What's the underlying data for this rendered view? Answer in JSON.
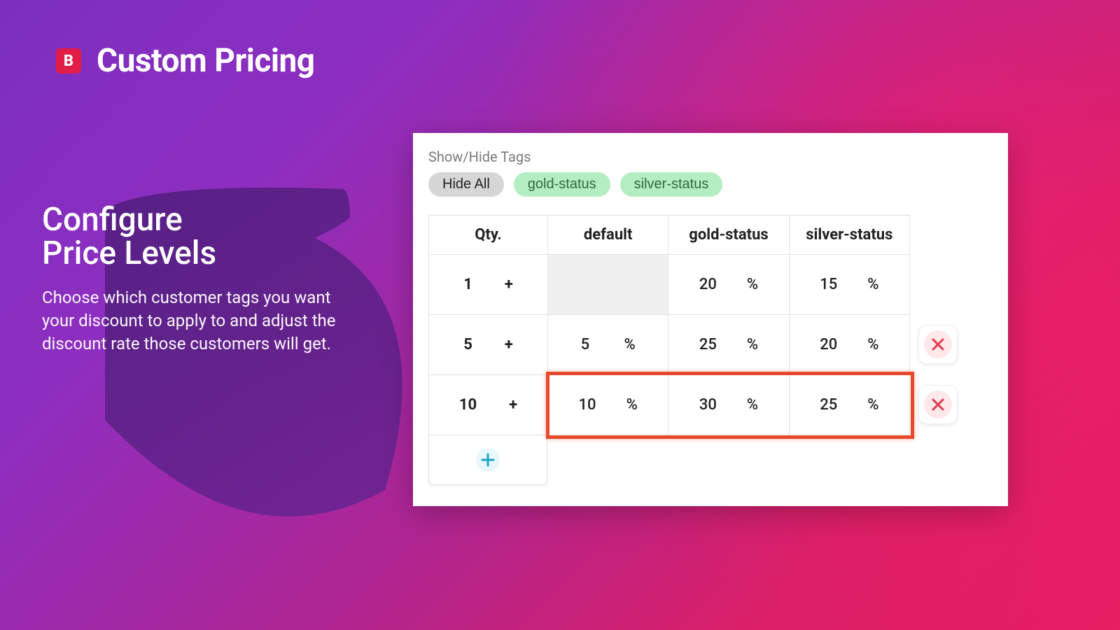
{
  "header": {
    "logo_letter": "B",
    "title": "Custom Pricing"
  },
  "copy": {
    "heading_l1": "Configure",
    "heading_l2": "Price Levels",
    "body": "Choose which customer tags you want your discount to apply to and adjust the discount rate those customers will get."
  },
  "tags": {
    "section_label": "Show/Hide Tags",
    "hide_all": "Hide All",
    "items": [
      "gold-status",
      "silver-status"
    ]
  },
  "table": {
    "columns": {
      "qty": "Qty.",
      "c0": "default",
      "c1": "gold-status",
      "c2": "silver-status"
    },
    "unit": "%",
    "qty_suffix": "+",
    "rows": [
      {
        "qty": "1",
        "default": "",
        "gold": "20",
        "silver": "15",
        "default_disabled": true,
        "deletable": false
      },
      {
        "qty": "5",
        "default": "5",
        "gold": "25",
        "silver": "20",
        "default_disabled": false,
        "deletable": true
      },
      {
        "qty": "10",
        "default": "10",
        "gold": "30",
        "silver": "25",
        "default_disabled": false,
        "deletable": true,
        "highlighted": true
      }
    ]
  }
}
